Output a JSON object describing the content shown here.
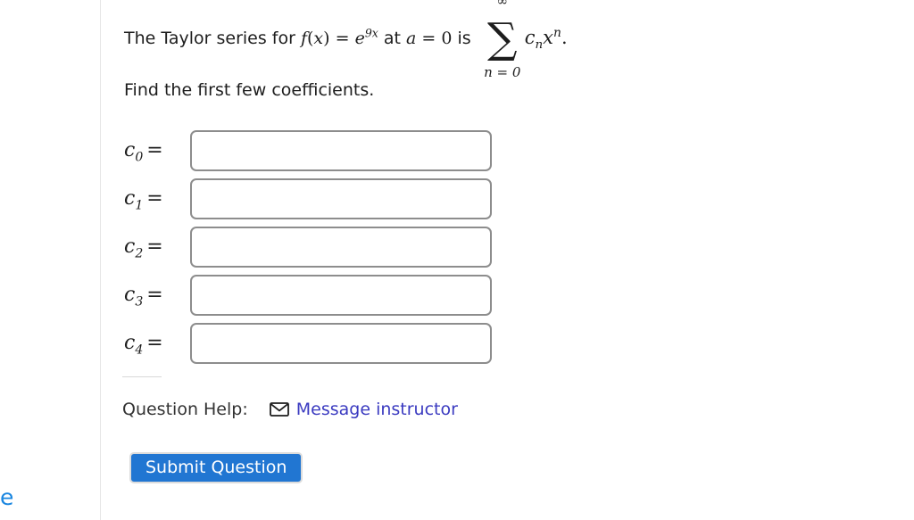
{
  "page": {
    "background_color": "#ffffff",
    "divider_color": "#e6e6e6"
  },
  "left_rail": {
    "cut_off_text": "e",
    "cut_off_color": "#1a86e0"
  },
  "prompt": {
    "lead_text": "The Taylor series for ",
    "function_f": "f",
    "function_arg_open": "(",
    "function_var": "x",
    "function_arg_close": ")",
    "equals_1": " = ",
    "exp_base": "e",
    "exp_power_coef": "9",
    "exp_power_var": "x",
    "at_text": " at ",
    "center_var": "a",
    "equals_2": " = ",
    "center_value": "0",
    "is_text": " is ",
    "sum_upper_limit": "∞",
    "sum_symbol": "∑",
    "sum_lower_limit": "n = 0",
    "sum_term_c": "c",
    "sum_term_c_sub": "n",
    "sum_term_x": "x",
    "sum_term_x_sup": "n",
    "trailing_period": ".",
    "instruction": "Find the first few coefficients."
  },
  "answers": {
    "rows": [
      {
        "label_c": "c",
        "label_sub": "0",
        "equals": "=",
        "value": "",
        "placeholder": ""
      },
      {
        "label_c": "c",
        "label_sub": "1",
        "equals": "=",
        "value": "",
        "placeholder": ""
      },
      {
        "label_c": "c",
        "label_sub": "2",
        "equals": "=",
        "value": "",
        "placeholder": ""
      },
      {
        "label_c": "c",
        "label_sub": "3",
        "equals": "=",
        "value": "",
        "placeholder": ""
      },
      {
        "label_c": "c",
        "label_sub": "4",
        "equals": "=",
        "value": "",
        "placeholder": ""
      }
    ]
  },
  "help": {
    "label": "Question Help:",
    "icon": "envelope-icon",
    "link_text": "Message instructor",
    "link_color": "#3a3ac0"
  },
  "submit": {
    "label": "Submit Question",
    "button_color": "#2176d2",
    "text_color": "#ffffff"
  }
}
